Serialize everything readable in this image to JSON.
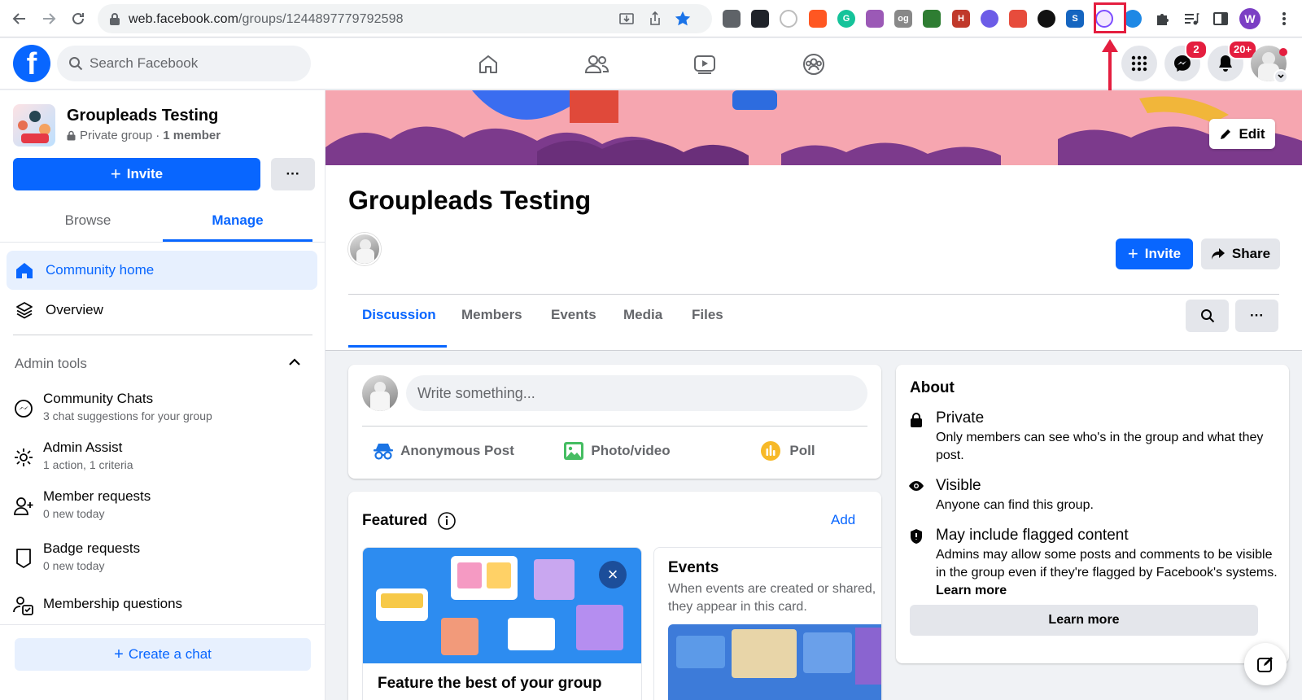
{
  "browser": {
    "url_host": "web.facebook.com",
    "url_path": "/groups/1244897779792598",
    "profile_initial": "W",
    "extensions": [
      {
        "name": "bug-ext-icon",
        "label": "",
        "color": "#5f6368"
      },
      {
        "name": "react-ext-icon",
        "label": "",
        "color": "#20232a"
      },
      {
        "name": "clock-ext-icon",
        "label": "",
        "color": "#bdbdbd"
      },
      {
        "name": "colorwheel-ext-icon",
        "label": "",
        "color": "#ff5722"
      },
      {
        "name": "grammarly-ext-icon",
        "label": "G",
        "color": "#15c39a"
      },
      {
        "name": "share-ext-icon",
        "label": "",
        "color": "#9b59b6"
      },
      {
        "name": "og-ext-icon",
        "label": "og",
        "color": "#888888"
      },
      {
        "name": "robot-ext-icon",
        "label": "",
        "color": "#2e7d32"
      },
      {
        "name": "h-ext-icon",
        "label": "H",
        "color": "#c0392b"
      },
      {
        "name": "purple-ext-icon",
        "label": "",
        "color": "#6c5ce7"
      },
      {
        "name": "car-ext-icon",
        "label": "",
        "color": "#e74c3c"
      },
      {
        "name": "circle-ext-icon",
        "label": "",
        "color": "#111111"
      },
      {
        "name": "s-ext-icon",
        "label": "S",
        "color": "#1565c0"
      },
      {
        "name": "groupleads-ext-icon",
        "label": "",
        "color": "#7c4dff"
      },
      {
        "name": "globe-ext-icon",
        "label": "",
        "color": "#1e88e5"
      }
    ]
  },
  "topbar": {
    "logo": "f",
    "search_placeholder": "Search Facebook",
    "messenger_badge": "2",
    "notif_badge": "20+"
  },
  "sidebar": {
    "group_name": "Groupleads Testing",
    "privacy": "Private group",
    "members": "1 member",
    "invite_label": "Invite",
    "more_label": "···",
    "tab_browse": "Browse",
    "tab_manage": "Manage",
    "community_home": "Community home",
    "overview": "Overview",
    "admin_tools": "Admin tools",
    "tools": [
      {
        "title": "Community Chats",
        "sub": "3 chat suggestions for your group"
      },
      {
        "title": "Admin Assist",
        "sub": "1 action, 1 criteria"
      },
      {
        "title": "Member requests",
        "sub": "0 new today"
      },
      {
        "title": "Badge requests",
        "sub": "0 new today"
      },
      {
        "title": "Membership questions",
        "sub": ""
      }
    ],
    "create_chat": "Create a chat"
  },
  "main": {
    "edit_label": "Edit",
    "group_title": "Groupleads Testing",
    "invite_label": "Invite",
    "share_label": "Share",
    "tabs": [
      "Discussion",
      "Members",
      "Events",
      "Media",
      "Files"
    ],
    "active_tab": "Discussion",
    "more_label": "···",
    "composer": {
      "placeholder": "Write something...",
      "anonymous": "Anonymous Post",
      "photo": "Photo/video",
      "poll": "Poll"
    },
    "featured": {
      "title": "Featured",
      "add": "Add",
      "card1_title": "Feature the best of your group",
      "card2_title": "Events",
      "card2_desc": "When events are created or shared, they appear in this card."
    }
  },
  "about": {
    "title": "About",
    "rows": [
      {
        "icon": "lock-icon",
        "heading": "Private",
        "desc": "Only members can see who's in the group and what they post."
      },
      {
        "icon": "eye-icon",
        "heading": "Visible",
        "desc": "Anyone can find this group."
      },
      {
        "icon": "shield-icon",
        "heading": "May include flagged content",
        "desc": "Admins may allow some posts and comments to be visible in the group even if they're flagged by Facebook's systems."
      }
    ],
    "inline_link": "Learn more",
    "learn_more": "Learn more"
  },
  "colors": {
    "accent": "#0866ff",
    "highlight": "#e41e3f"
  }
}
